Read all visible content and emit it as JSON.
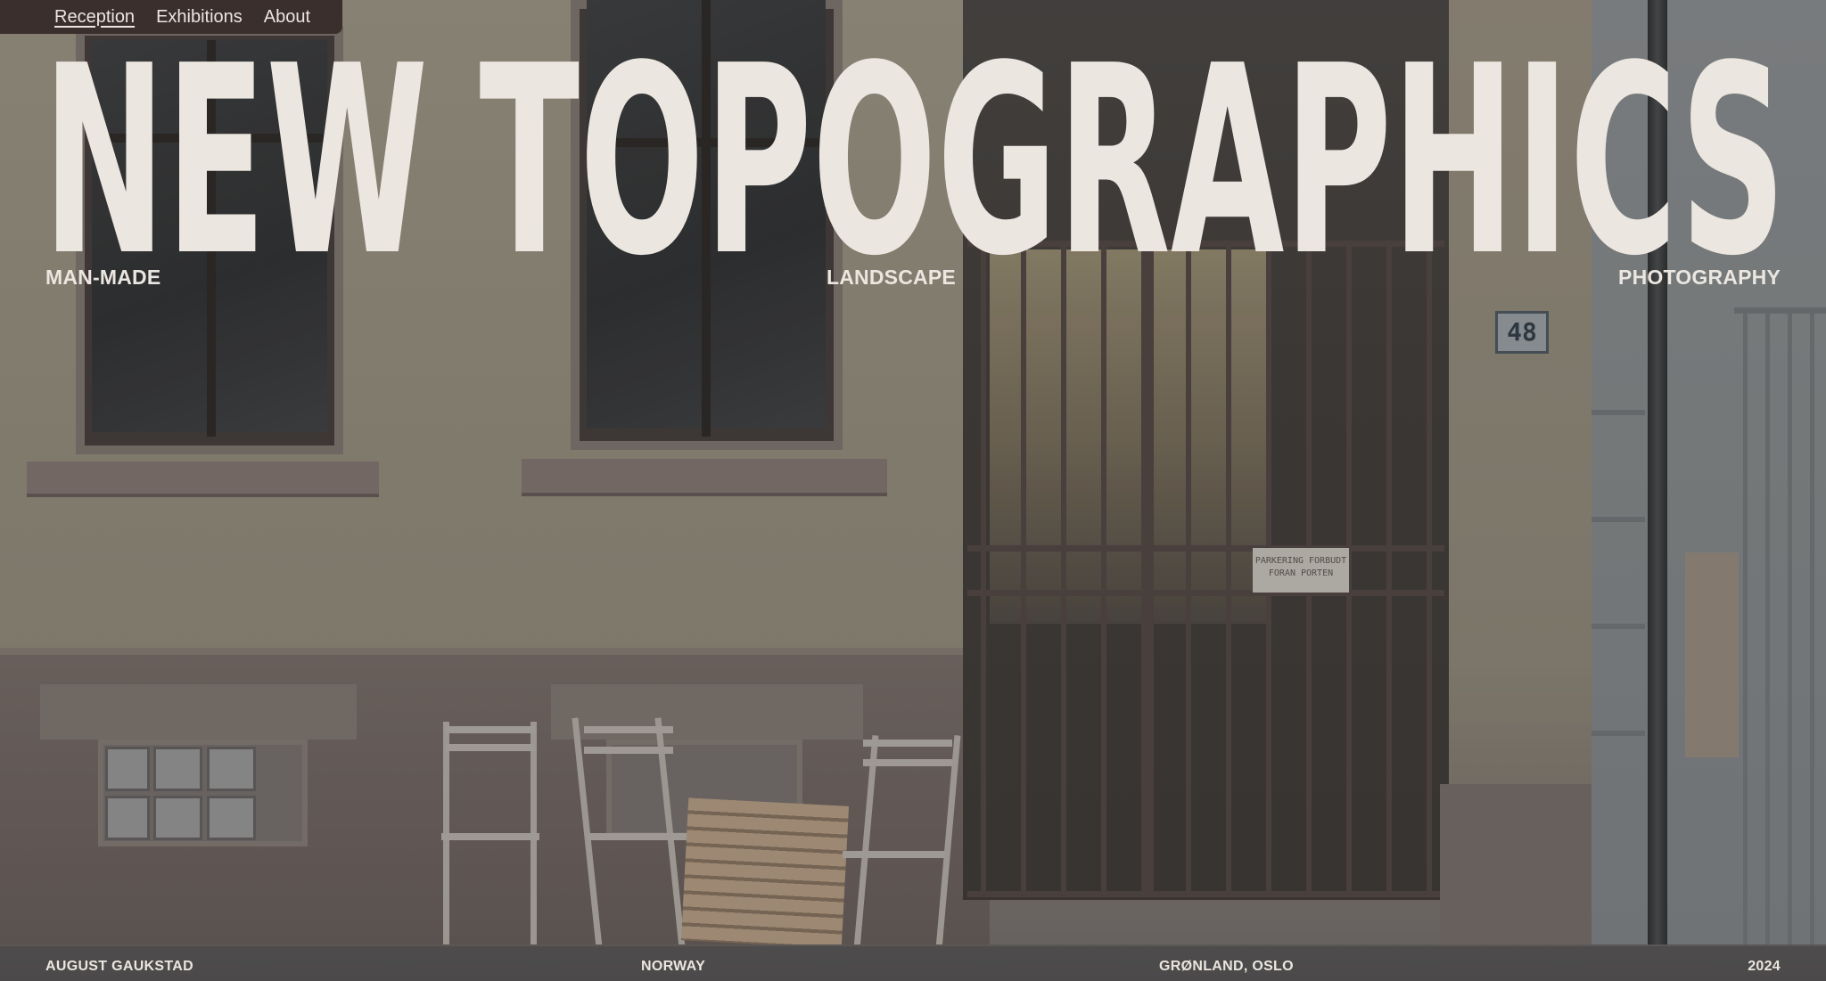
{
  "nav": {
    "items": [
      {
        "label": "Reception",
        "active": true
      },
      {
        "label": "Exhibitions",
        "active": false
      },
      {
        "label": "About",
        "active": false
      }
    ]
  },
  "hero": {
    "title": "NEW TOPOGRAPHICS",
    "subtitle_left": "MAN-MADE",
    "subtitle_center": "LANDSCAPE",
    "subtitle_right": "PHOTOGRAPHY"
  },
  "photo": {
    "house_number": "48",
    "sign_line1": "PARKERING FORBUDT",
    "sign_line2": "FORAN PORTEN"
  },
  "footer": {
    "photographer": "AUGUST GAUKSTAD",
    "country": "NORWAY",
    "location": "GRØNLAND, OSLO",
    "year": "2024"
  },
  "colors": {
    "text": "#ebe6e0",
    "nav_background": "#3a2f2c"
  }
}
